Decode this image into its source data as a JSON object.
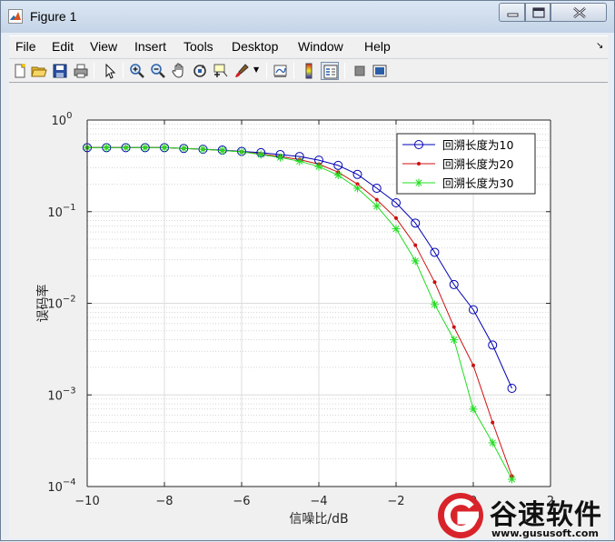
{
  "window": {
    "title": "Figure 1"
  },
  "menu": {
    "items": [
      "File",
      "Edit",
      "View",
      "Insert",
      "Tools",
      "Desktop",
      "Window",
      "Help"
    ]
  },
  "toolbar": {
    "icons": [
      "new-figure-icon",
      "open-file-icon",
      "save-icon",
      "print-icon",
      "pointer-icon",
      "zoom-in-icon",
      "zoom-out-icon",
      "pan-icon",
      "rotate-icon",
      "data-cursor-icon",
      "brush-icon",
      "link-plot-icon",
      "colorbar-icon",
      "legend-icon",
      "hide-plot-tools-icon",
      "show-plot-tools-icon"
    ]
  },
  "watermark": {
    "name": "谷速软件",
    "url": "www.gususoft.com",
    "color": "#d9232a"
  },
  "chart_data": {
    "type": "line",
    "title": "",
    "xlabel": "信噪比/dB",
    "ylabel": "误码率",
    "xlim": [
      -10,
      2
    ],
    "ylim": [
      0.0001,
      1
    ],
    "yscale": "log",
    "grid": true,
    "minor_grid": true,
    "x_ticks": [
      "-10",
      "-8",
      "-6",
      "-4",
      "-2",
      "0",
      "2"
    ],
    "y_ticks_base": [
      "10",
      "10",
      "10",
      "10",
      "10"
    ],
    "y_ticks_exp": [
      "-4",
      "-3",
      "-2",
      "-1",
      "0"
    ],
    "legend_position": "top-right",
    "series": [
      {
        "name": "回溯长度为10",
        "color": "#0000b3",
        "marker": "circle",
        "x": [
          -10,
          -9.5,
          -9,
          -8.5,
          -8,
          -7.5,
          -7,
          -6.5,
          -6,
          -5.5,
          -5,
          -4.5,
          -4,
          -3.5,
          -3,
          -2.5,
          -2,
          -1.5,
          -1,
          -0.5,
          0,
          0.5,
          1
        ],
        "y": [
          0.5,
          0.5,
          0.5,
          0.5,
          0.5,
          0.49,
          0.48,
          0.47,
          0.455,
          0.44,
          0.42,
          0.4,
          0.365,
          0.32,
          0.255,
          0.18,
          0.125,
          0.075,
          0.036,
          0.016,
          0.0085,
          0.0035,
          0.00118
        ]
      },
      {
        "name": "回溯长度为20",
        "color": "#cc1010",
        "marker": "dot",
        "x": [
          -10,
          -9.5,
          -9,
          -8.5,
          -8,
          -7.5,
          -7,
          -6.5,
          -6,
          -5.5,
          -5,
          -4.5,
          -4,
          -3.5,
          -3,
          -2.5,
          -2,
          -1.5,
          -1,
          -0.5,
          0,
          0.5,
          1
        ],
        "y": [
          0.5,
          0.5,
          0.5,
          0.5,
          0.5,
          0.49,
          0.48,
          0.465,
          0.45,
          0.425,
          0.4,
          0.37,
          0.33,
          0.27,
          0.2,
          0.135,
          0.085,
          0.043,
          0.017,
          0.0055,
          0.0021,
          0.0005,
          0.00013
        ]
      },
      {
        "name": "回溯长度为30",
        "color": "#22dd22",
        "marker": "star",
        "x": [
          -10,
          -9.5,
          -9,
          -8.5,
          -8,
          -7.5,
          -7,
          -6.5,
          -6,
          -5.5,
          -5,
          -4.5,
          -4,
          -3.5,
          -3,
          -2.5,
          -2,
          -1.5,
          -1,
          -0.5,
          0,
          0.5,
          1
        ],
        "y": [
          0.5,
          0.5,
          0.5,
          0.5,
          0.5,
          0.49,
          0.48,
          0.465,
          0.45,
          0.42,
          0.39,
          0.355,
          0.31,
          0.25,
          0.18,
          0.115,
          0.065,
          0.029,
          0.0097,
          0.004,
          0.0007,
          0.0003,
          0.00012
        ]
      }
    ]
  }
}
